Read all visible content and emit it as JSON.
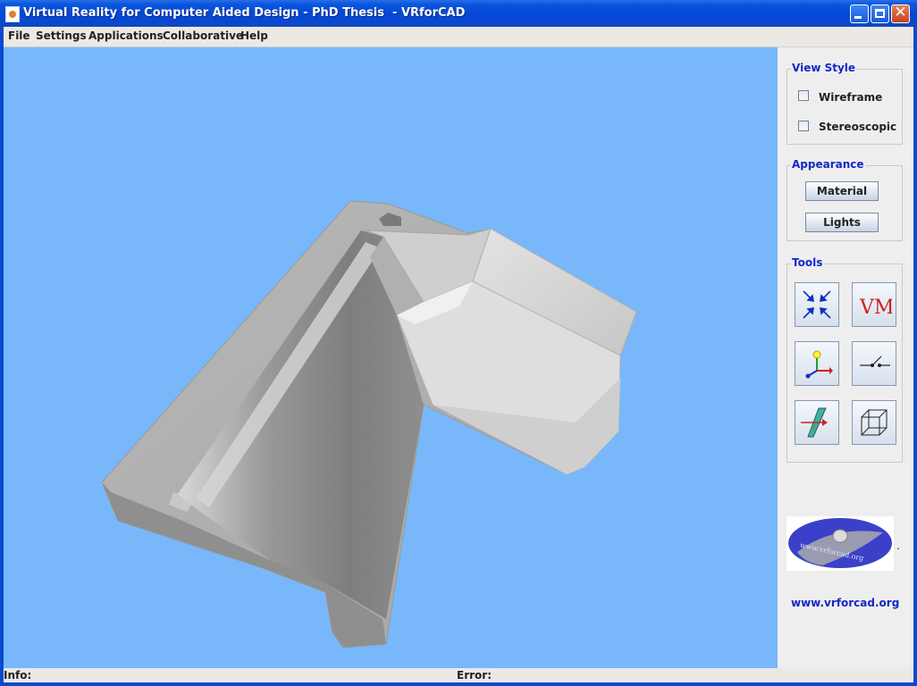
{
  "window": {
    "title": "Virtual Reality for Computer Aided Design - PhD Thesis  - VRforCAD",
    "minimize_glyph": "",
    "maximize_glyph": "",
    "close_glyph": "✕"
  },
  "menu": {
    "items": [
      "File",
      "Settings",
      "Applications",
      "Collaborative",
      "Help"
    ]
  },
  "panel": {
    "view_style": {
      "title": "View Style",
      "wireframe": {
        "label": "Wireframe",
        "checked": false
      },
      "stereoscopic": {
        "label": "Stereoscopic",
        "checked": false
      }
    },
    "appearance": {
      "title": "Appearance",
      "material_label": "Material",
      "lights_label": "Lights"
    },
    "tools": {
      "title": "Tools",
      "icons": [
        "arrows-inward-icon",
        "vm-icon",
        "axes-icon",
        "connection-icon",
        "section-plane-icon",
        "bounding-box-icon"
      ],
      "vm_text": "VM"
    },
    "logo_text": "www.vrforcad.org",
    "link_text": "www.vrforcad.org",
    "dot": "."
  },
  "status": {
    "info_label": "Info:",
    "error_label": "Error:"
  },
  "colors": {
    "viewport_bg": "#78b8fa",
    "group_title": "#1428c8",
    "titlebar": "#0a58de",
    "model_gray": "#b4b4b4"
  }
}
